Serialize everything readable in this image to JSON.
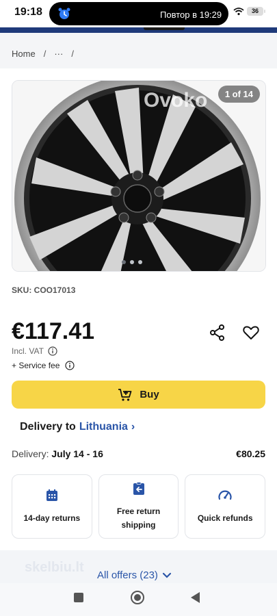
{
  "status_bar": {
    "time": "19:18",
    "notification": "Повтор в 19:29",
    "battery": "36"
  },
  "breadcrumb": {
    "home": "Home",
    "ellipsis": "···",
    "separator": "/"
  },
  "gallery": {
    "counter": "1 of 14",
    "watermark": "Ovoko",
    "total_images": 14,
    "current_image": 1
  },
  "product": {
    "sku": "SKU: COO17013",
    "price": "€117.41",
    "vat_note": "Incl. VAT",
    "service_fee": "+ Service fee"
  },
  "buy_button": {
    "label": "Buy"
  },
  "delivery": {
    "to_prefix": "Delivery to",
    "country": "Lithuania",
    "label": "Delivery:",
    "dates": "July 14 - 16",
    "price": "€80.25"
  },
  "features": [
    {
      "label": "14-day returns",
      "icon": "calendar-icon"
    },
    {
      "label": "Free return shipping",
      "icon": "return-box-icon"
    },
    {
      "label": "Quick refunds",
      "icon": "speedometer-icon"
    }
  ],
  "offers": {
    "label": "All offers (23)",
    "watermark": "skelbiu.lt"
  },
  "colors": {
    "brand_blue": "#2a55a8",
    "buy_yellow": "#f7d547",
    "header_navy": "#1f3a7a"
  }
}
